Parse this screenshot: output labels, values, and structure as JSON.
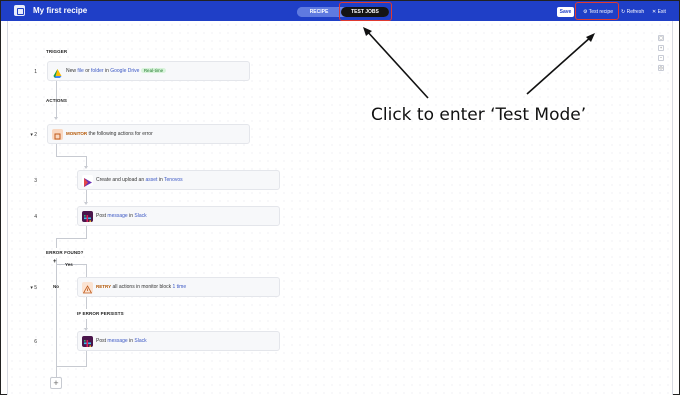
{
  "header": {
    "title": "My first recipe",
    "tabs": [
      {
        "label": "RECIPE"
      },
      {
        "label": "TEST JOBS"
      }
    ],
    "save_label": "Save",
    "test_recipe_label": "Test recipe",
    "refresh_label": "Refresh",
    "exit_label": "Exit"
  },
  "recipe": {
    "trigger_label": "TRIGGER",
    "actions_label": "ACTIONS",
    "steps": [
      {
        "num": "1",
        "pre": "New ",
        "a": "file",
        "mid": " or ",
        "b": "folder",
        "mid2": " in ",
        "app": "Google Drive",
        "badge": "Real-time"
      },
      {
        "num": "2",
        "keyword": "MONITOR",
        "rest": " the following actions for error"
      },
      {
        "num": "3",
        "pre": "Create and upload an ",
        "obj": "asset",
        "mid": " in ",
        "app": "Tenovos"
      },
      {
        "num": "4",
        "pre": "Post ",
        "obj": "message",
        "mid": " in ",
        "app": "Slack"
      },
      {
        "num": "5",
        "keyword": "RETRY",
        "rest": " all actions in monitor block ",
        "count": "1 time"
      },
      {
        "num": "6",
        "pre": "Post ",
        "obj": "message",
        "mid": " in ",
        "app": "Slack"
      }
    ],
    "error_found_label": "ERROR FOUND?",
    "yes_label": "Yes",
    "no_label": "No",
    "if_error_label": "IF ERROR PERSISTS"
  },
  "annotation": {
    "text": "Click to enter ‘Test Mode’",
    "color": "#e0392f"
  },
  "colors": {
    "header": "#1f3fc7",
    "link": "#3b57c4",
    "accent_red": "#e0392f"
  }
}
